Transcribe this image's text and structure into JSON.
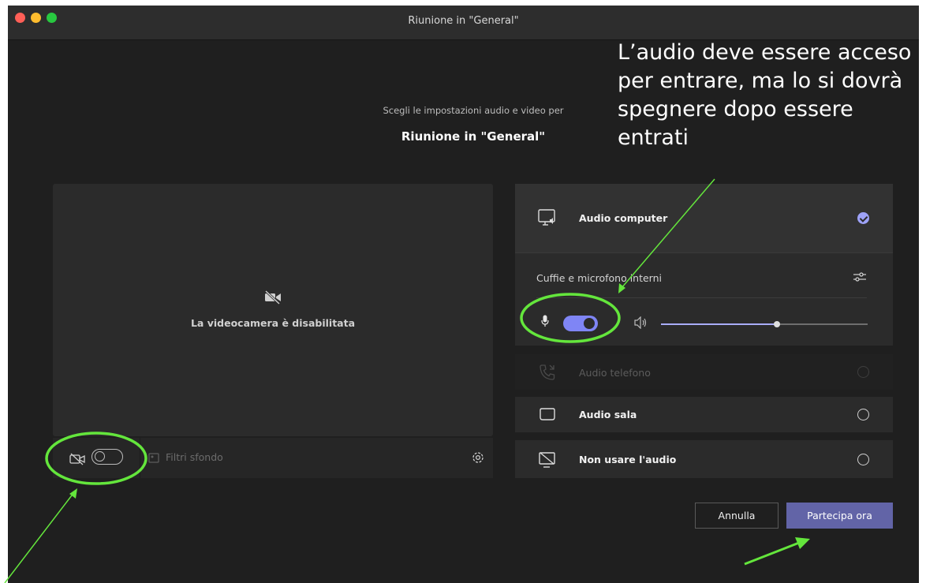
{
  "window": {
    "title": "Riunione in \"General\""
  },
  "header": {
    "subtitle": "Scegli le impostazioni audio e video per",
    "meeting_name": "Riunione in \"General\""
  },
  "video": {
    "camera_disabled_text": "La videocamera è disabilitata",
    "camera_enabled": false,
    "background_filters_label": "Filtri sfondo"
  },
  "audio": {
    "computer": {
      "label": "Audio computer",
      "selected": true,
      "device_name": "Cuffie e microfono interni",
      "mic_enabled": true,
      "volume": 0.56
    },
    "phone": {
      "label": "Audio telefono",
      "disabled": true
    },
    "room": {
      "label": "Audio sala"
    },
    "none": {
      "label": "Non usare l'audio"
    }
  },
  "buttons": {
    "cancel": "Annulla",
    "join": "Partecipa ora"
  },
  "annotation": {
    "text": "L’audio deve essere acceso per entrare, ma lo si dovrà spegnere dopo essere entrati",
    "highlight_color": "#64e63c"
  },
  "colors": {
    "accent": "#7f85f5",
    "join_button": "#6264a7",
    "background": "#1f1f1f"
  }
}
